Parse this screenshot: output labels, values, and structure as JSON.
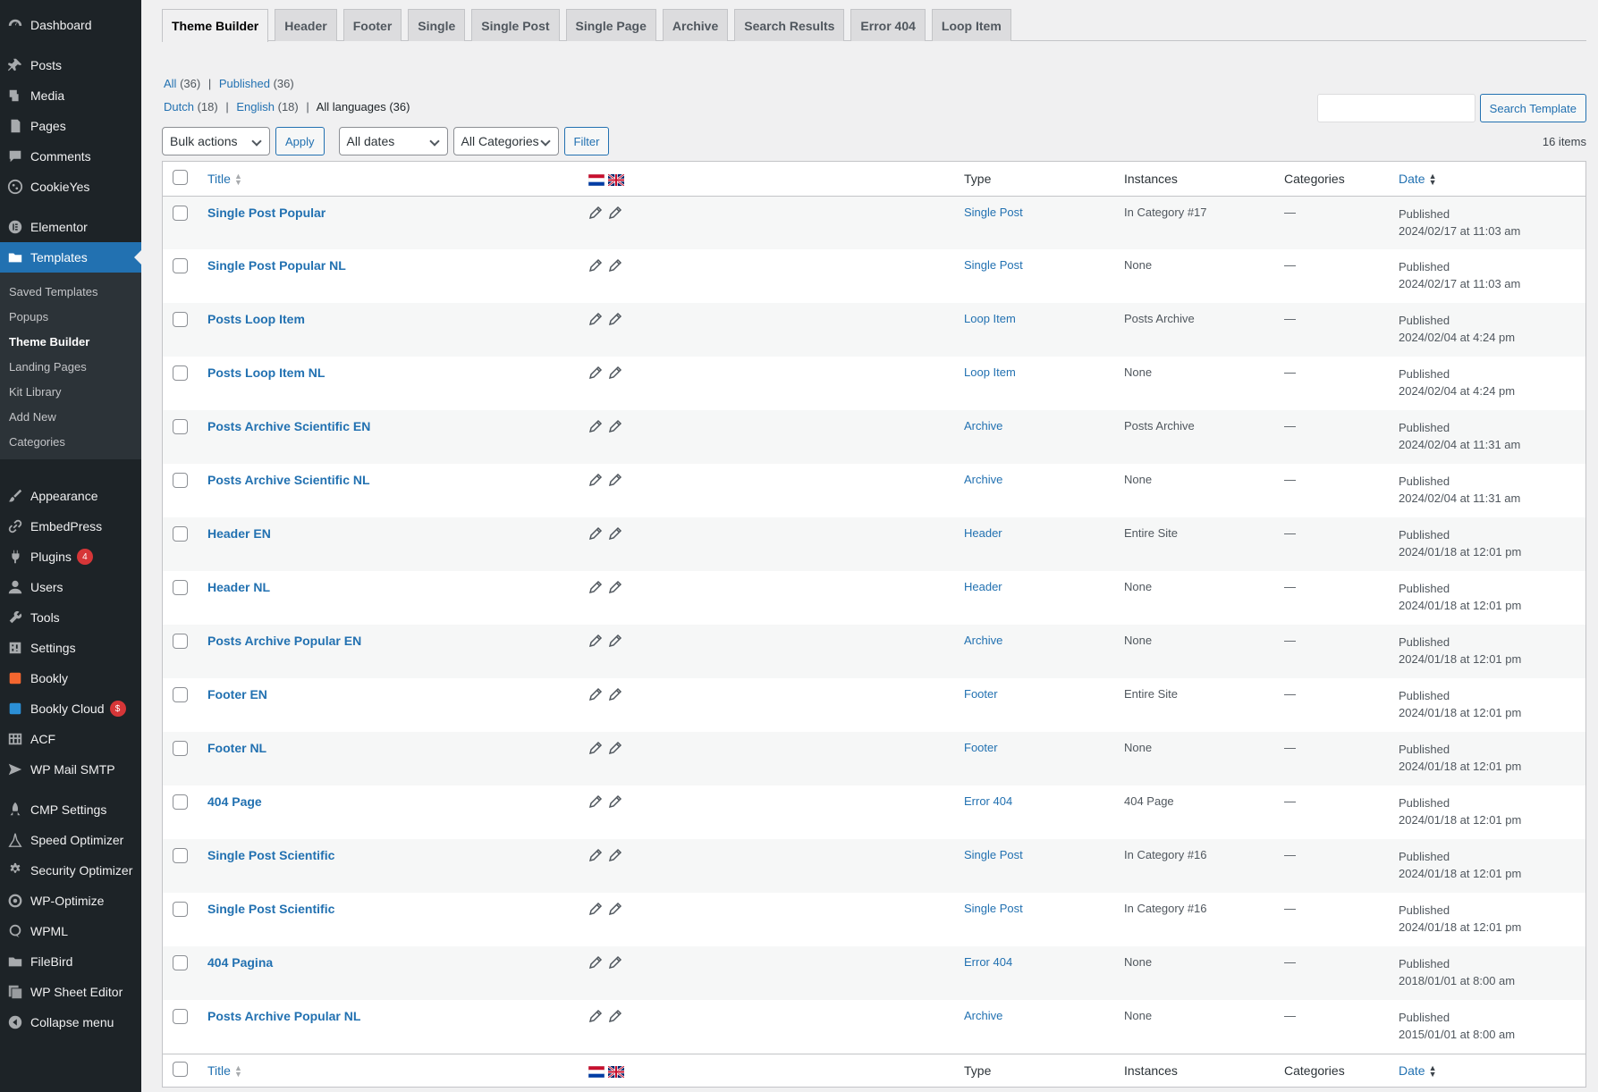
{
  "sidebar": {
    "items": [
      {
        "label": "Dashboard",
        "icon": "dashboard-icon"
      },
      {
        "label": "Posts",
        "icon": "pushpin-icon"
      },
      {
        "label": "Media",
        "icon": "media-icon"
      },
      {
        "label": "Pages",
        "icon": "pages-icon"
      },
      {
        "label": "Comments",
        "icon": "comment-icon"
      },
      {
        "label": "CookieYes",
        "icon": "cookie-icon"
      },
      {
        "label": "Elementor",
        "icon": "elementor-icon"
      },
      {
        "label": "Templates",
        "icon": "folder-icon"
      },
      {
        "label": "Appearance",
        "icon": "brush-icon"
      },
      {
        "label": "EmbedPress",
        "icon": "link-icon"
      },
      {
        "label": "Plugins",
        "icon": "plug-icon",
        "badge": "4"
      },
      {
        "label": "Users",
        "icon": "user-icon"
      },
      {
        "label": "Tools",
        "icon": "wrench-icon"
      },
      {
        "label": "Settings",
        "icon": "settings-icon"
      },
      {
        "label": "Bookly",
        "icon": "bookly-icon"
      },
      {
        "label": "Bookly Cloud",
        "icon": "cloud-icon",
        "badge": "$"
      },
      {
        "label": "ACF",
        "icon": "grid-icon"
      },
      {
        "label": "WP Mail SMTP",
        "icon": "mail-icon"
      },
      {
        "label": "CMP Settings",
        "icon": "rocket-icon"
      },
      {
        "label": "Speed Optimizer",
        "icon": "speed-icon"
      },
      {
        "label": "Security Optimizer",
        "icon": "gear-icon"
      },
      {
        "label": "WP-Optimize",
        "icon": "optimize-icon"
      },
      {
        "label": "WPML",
        "icon": "wpml-icon"
      },
      {
        "label": "FileBird",
        "icon": "folder-icon"
      },
      {
        "label": "WP Sheet Editor",
        "icon": "sheet-icon"
      },
      {
        "label": "Collapse menu",
        "icon": "collapse-icon"
      }
    ],
    "submenu": [
      {
        "label": "Saved Templates"
      },
      {
        "label": "Popups"
      },
      {
        "label": "Theme Builder"
      },
      {
        "label": "Landing Pages"
      },
      {
        "label": "Kit Library"
      },
      {
        "label": "Add New"
      },
      {
        "label": "Categories"
      }
    ]
  },
  "tabs": [
    "Theme Builder",
    "Header",
    "Footer",
    "Single",
    "Single Post",
    "Single Page",
    "Archive",
    "Search Results",
    "Error 404",
    "Loop Item"
  ],
  "filters": {
    "all": "All",
    "all_count": "(36)",
    "published": "Published",
    "published_count": "(36)",
    "dutch": "Dutch",
    "dutch_count": "(18)",
    "english": "English",
    "english_count": "(18)",
    "all_languages": "All languages (36)",
    "sep": "|"
  },
  "search": {
    "button": "Search Template"
  },
  "tablenav": {
    "bulk": "Bulk actions",
    "apply": "Apply",
    "dates": "All dates",
    "categories": "All Categories",
    "filter": "Filter",
    "count": "16 items"
  },
  "columns": {
    "title": "Title",
    "type": "Type",
    "instances": "Instances",
    "categories": "Categories",
    "date": "Date"
  },
  "colors": {
    "accent": "#2271b1",
    "sidebar": "#1d2327",
    "badge": "#d63638"
  },
  "rows": [
    {
      "title": "Single Post Popular",
      "type": "Single Post",
      "instances": "In Category #17",
      "categories": "—",
      "status": "Published",
      "date": "2024/02/17 at 11:03 am"
    },
    {
      "title": "Single Post Popular NL",
      "type": "Single Post",
      "instances": "None",
      "categories": "—",
      "status": "Published",
      "date": "2024/02/17 at 11:03 am"
    },
    {
      "title": "Posts Loop Item",
      "type": "Loop Item",
      "instances": "Posts Archive",
      "categories": "—",
      "status": "Published",
      "date": "2024/02/04 at 4:24 pm"
    },
    {
      "title": "Posts Loop Item NL",
      "type": "Loop Item",
      "instances": "None",
      "categories": "—",
      "status": "Published",
      "date": "2024/02/04 at 4:24 pm"
    },
    {
      "title": "Posts Archive Scientific EN",
      "type": "Archive",
      "instances": "Posts Archive",
      "categories": "—",
      "status": "Published",
      "date": "2024/02/04 at 11:31 am"
    },
    {
      "title": "Posts Archive Scientific NL",
      "type": "Archive",
      "instances": "None",
      "categories": "—",
      "status": "Published",
      "date": "2024/02/04 at 11:31 am"
    },
    {
      "title": "Header EN",
      "type": "Header",
      "instances": "Entire Site",
      "categories": "—",
      "status": "Published",
      "date": "2024/01/18 at 12:01 pm"
    },
    {
      "title": "Header NL",
      "type": "Header",
      "instances": "None",
      "categories": "—",
      "status": "Published",
      "date": "2024/01/18 at 12:01 pm"
    },
    {
      "title": "Posts Archive Popular EN",
      "type": "Archive",
      "instances": "None",
      "categories": "—",
      "status": "Published",
      "date": "2024/01/18 at 12:01 pm"
    },
    {
      "title": "Footer EN",
      "type": "Footer",
      "instances": "Entire Site",
      "categories": "—",
      "status": "Published",
      "date": "2024/01/18 at 12:01 pm"
    },
    {
      "title": "Footer NL",
      "type": "Footer",
      "instances": "None",
      "categories": "—",
      "status": "Published",
      "date": "2024/01/18 at 12:01 pm"
    },
    {
      "title": "404 Page",
      "type": "Error 404",
      "instances": "404 Page",
      "categories": "—",
      "status": "Published",
      "date": "2024/01/18 at 12:01 pm"
    },
    {
      "title": "Single Post Scientific",
      "type": "Single Post",
      "instances": "In Category #16",
      "categories": "—",
      "status": "Published",
      "date": "2024/01/18 at 12:01 pm"
    },
    {
      "title": "Single Post Scientific",
      "type": "Single Post",
      "instances": "In Category #16",
      "categories": "—",
      "status": "Published",
      "date": "2024/01/18 at 12:01 pm"
    },
    {
      "title": "404 Pagina",
      "type": "Error 404",
      "instances": "None",
      "categories": "—",
      "status": "Published",
      "date": "2018/01/01 at 8:00 am"
    },
    {
      "title": "Posts Archive Popular NL",
      "type": "Archive",
      "instances": "None",
      "categories": "—",
      "status": "Published",
      "date": "2015/01/01 at 8:00 am"
    }
  ]
}
